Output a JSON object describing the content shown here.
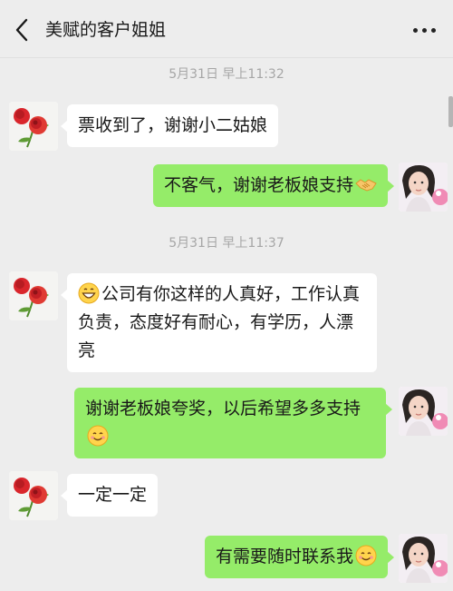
{
  "header": {
    "title": "美赋的客户姐姐",
    "back_icon": "chevron-left-icon",
    "more_icon": "ellipsis-icon"
  },
  "colors": {
    "background": "#ededed",
    "incoming_bubble": "#ffffff",
    "outgoing_bubble": "#95ec69",
    "timestamp": "#a6a6a6"
  },
  "timestamps": [
    "5月31日 早上11:32",
    "5月31日 早上11:37"
  ],
  "messages": [
    {
      "side": "left",
      "text": "票收到了，谢谢小二姑娘"
    },
    {
      "side": "right",
      "text": "不客气，谢谢老板娘支持",
      "trailing_emoji": "handshake-emoji"
    },
    {
      "side": "left",
      "leading_emoji": "grin-emoji",
      "text": "公司有你这样的人真好，工作认真负责，态度好有耐心，有学历，人漂亮"
    },
    {
      "side": "right",
      "text": "谢谢老板娘夸奖，以后希望多多支持",
      "trailing_emoji": "smile-emoji"
    },
    {
      "side": "left",
      "text": "一定一定"
    },
    {
      "side": "right",
      "text": "有需要随时联系我",
      "trailing_emoji": "smile-emoji"
    }
  ],
  "avatars": {
    "contact": "rose-avatar",
    "self": "girl-photo-avatar"
  }
}
